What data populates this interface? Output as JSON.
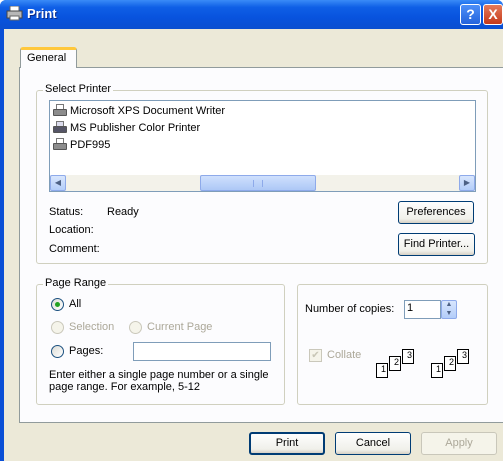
{
  "window": {
    "title": "Print",
    "help_button": "?",
    "close_button": "X"
  },
  "tabs": [
    {
      "label": "General",
      "active": true
    }
  ],
  "select_printer": {
    "legend": "Select Printer",
    "printers": [
      {
        "name": "Microsoft XPS Document Writer",
        "icon": "printer-icon"
      },
      {
        "name": "MS Publisher Color Printer",
        "icon": "network-printer-icon"
      },
      {
        "name": "PDF995",
        "icon": "printer-icon"
      }
    ],
    "status_label": "Status:",
    "status_value": "Ready",
    "location_label": "Location:",
    "location_value": "",
    "comment_label": "Comment:",
    "comment_value": "",
    "preferences_button": "Preferences",
    "find_printer_button": "Find Printer..."
  },
  "page_range": {
    "legend": "Page Range",
    "options": [
      {
        "label": "All",
        "checked": true,
        "enabled": true
      },
      {
        "label": "Selection",
        "checked": false,
        "enabled": false
      },
      {
        "label": "Current Page",
        "checked": false,
        "enabled": false
      },
      {
        "label": "Pages:",
        "checked": false,
        "enabled": true
      }
    ],
    "pages_value": "",
    "hint": "Enter either a single page number or a single page range.  For example, 5-12"
  },
  "copies": {
    "label": "Number of copies:",
    "value": "1",
    "collate_label": "Collate",
    "collate_checked": true,
    "collate_enabled": false,
    "collate_page_numbers": [
      "1",
      "2",
      "3"
    ]
  },
  "footer": {
    "print_button": "Print",
    "cancel_button": "Cancel",
    "apply_button": "Apply"
  },
  "colors": {
    "title_bar": "#0a4fd6",
    "dialog_bg": "#ece9d8",
    "tab_accent": "#ffc83c",
    "radio_dot": "#21a121"
  }
}
